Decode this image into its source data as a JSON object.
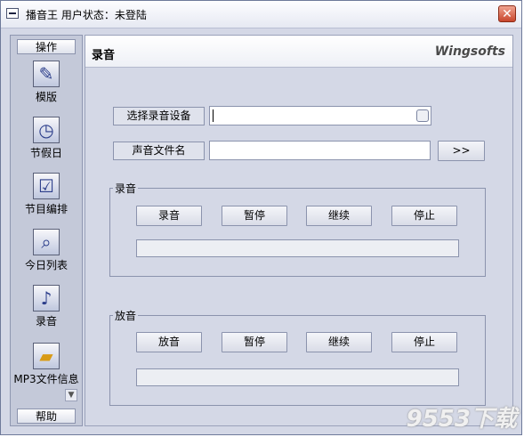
{
  "window": {
    "title": "播音王  用户状态：未登陆",
    "close_glyph": "✕"
  },
  "sidebar": {
    "header": "操作",
    "footer": "帮助",
    "items": [
      {
        "label": "模版",
        "icon": "template-icon",
        "glyph": "✎"
      },
      {
        "label": "节假日",
        "icon": "clock-icon",
        "glyph": "◷"
      },
      {
        "label": "节目编排",
        "icon": "schedule-icon",
        "glyph": "☑"
      },
      {
        "label": "今日列表",
        "icon": "search-list-icon",
        "glyph": "⌕"
      },
      {
        "label": "录音",
        "icon": "music-note-icon",
        "glyph": "♪"
      },
      {
        "label": "MP3文件信息",
        "icon": "folder-icon",
        "glyph": "▰"
      }
    ]
  },
  "panel": {
    "title": "录音",
    "brand": "Wingsofts",
    "device_label": "选择录音设备",
    "device_value": "",
    "filename_label": "声音文件名",
    "filename_value": "",
    "browse_button": ">>"
  },
  "record_group": {
    "label": "录音",
    "buttons": [
      "录音",
      "暂停",
      "继续",
      "停止"
    ],
    "progress": 0
  },
  "play_group": {
    "label": "放音",
    "buttons": [
      "放音",
      "暂停",
      "继续",
      "停止"
    ],
    "progress": 0
  },
  "watermark": "9553下载",
  "colors": {
    "accent": "#4d6fc9",
    "close": "#c8462c",
    "background": "#d4d8e6"
  }
}
